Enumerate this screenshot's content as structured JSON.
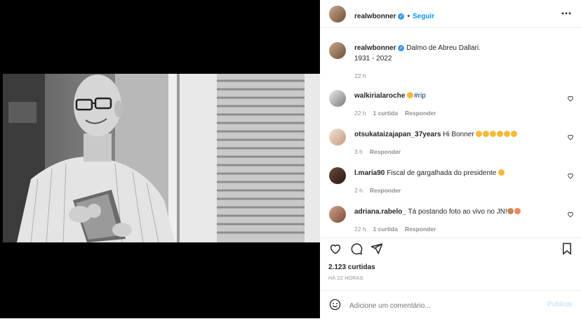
{
  "post": {
    "image_alt": "Foto em preto e branco de um senhor de óculos segurando um livro"
  },
  "header": {
    "username": "realwbonner",
    "verified": "✓",
    "dot": "•",
    "follow_label": "Seguir",
    "more_icon": "ellipsis-icon"
  },
  "caption": {
    "username": "realwbonner",
    "verified": "✓",
    "text_line1": "Dalmo de Abreu Dallari.",
    "text_line2": "1931 - 2022",
    "time": "22 h"
  },
  "comments": [
    {
      "username": "walkirialaroche",
      "emoji": "😭",
      "text": "#rip",
      "time": "22 h",
      "likes": "1 curtida",
      "reply": "Responder"
    },
    {
      "username": "otsukataizajapan_37years",
      "text": "Hi Bonner",
      "emojis": "👏👏😭😭👏👏",
      "time": "3 h",
      "reply": "Responder"
    },
    {
      "username": "l.maria90",
      "text": "Fiscal de gargalhada do presidente",
      "emoji": "😂",
      "time": "2 h",
      "reply": "Responder"
    },
    {
      "username": "adriana.rabelo_",
      "text": "Tá postando foto ao vivo no JN!",
      "emojis": "👏🥰",
      "time": "22 h",
      "likes": "1 curtida",
      "reply": "Responder"
    }
  ],
  "actions": {
    "likes_count": "2.123 curtidas",
    "post_time": "HÁ 22 HORAS"
  },
  "composer": {
    "placeholder": "Adicione um comentário...",
    "publish_label": "Publicar"
  },
  "colors": {
    "accent": "#0095f6",
    "verified": "#3897f0",
    "text": "#262626",
    "muted": "#8e8e8e",
    "publish_disabled": "#b2dffc"
  }
}
